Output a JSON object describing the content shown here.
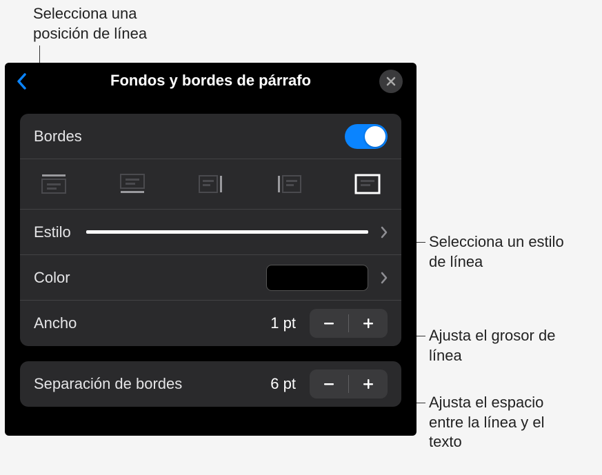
{
  "callouts": {
    "position": "Selecciona una posición de línea",
    "style": "Selecciona un estilo de línea",
    "width": "Ajusta el grosor de línea",
    "offset": "Ajusta el espacio entre la línea y el texto"
  },
  "panel": {
    "title": "Fondos y bordes de párrafo",
    "borders": {
      "label": "Bordes",
      "enabled": true
    },
    "style": {
      "label": "Estilo"
    },
    "color": {
      "label": "Color",
      "value": "#000000"
    },
    "width": {
      "label": "Ancho",
      "value": "1 pt"
    },
    "offset": {
      "label": "Separación de bordes",
      "value": "6 pt"
    }
  }
}
